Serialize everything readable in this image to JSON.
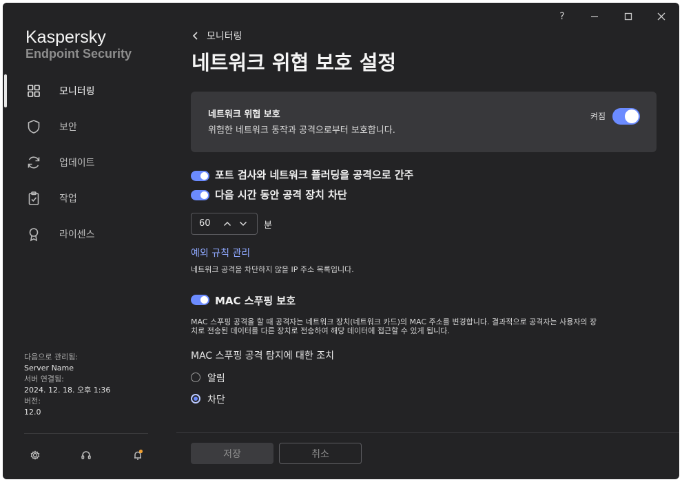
{
  "window": {
    "help_glyph": "?",
    "icons": [
      "help-icon",
      "minimize-icon",
      "maximize-icon",
      "close-icon"
    ]
  },
  "brand": {
    "line1": "Kaspersky",
    "line2": "Endpoint Security"
  },
  "sidebar": {
    "items": [
      {
        "label": "모니터링",
        "icon": "grid-icon",
        "active": true
      },
      {
        "label": "보안",
        "icon": "shield-icon",
        "active": false
      },
      {
        "label": "업데이트",
        "icon": "refresh-icon",
        "active": false
      },
      {
        "label": "작업",
        "icon": "clipboard-check-icon",
        "active": false
      },
      {
        "label": "라이센스",
        "icon": "award-icon",
        "active": false
      }
    ],
    "managed": {
      "managed_by_label": "다음으로 관리됨:",
      "managed_by_value": "Server Name",
      "server_conn_label": "서버 연결됨:",
      "server_conn_value": "2024. 12. 18. 오후 1:36",
      "version_label": "버전:",
      "version_value": "12.0"
    },
    "bottom_icons": [
      "settings-icon",
      "support-headset-icon",
      "notifications-bell-icon"
    ]
  },
  "main": {
    "back_label": "모니터링",
    "title": "네트워크 위협 보호 설정",
    "card": {
      "title": "네트워크 위협 보호",
      "description": "위험한 네트워크 동작과 공격으로부터 보호합니다.",
      "toggle_label": "켜짐"
    },
    "options": {
      "port_scan_label": "포트 검사와 네트워크 플러딩을 공격으로 간주",
      "block_label": "다음 시간 동안 공격 장치 차단",
      "block_value": "60",
      "block_unit": "분",
      "exclusions_link": "예외 규칙 관리",
      "exclusions_desc": "네트워크 공격을 차단하지 않을 IP 주소 목록입니다.",
      "mac_label": "MAC 스푸핑 보호",
      "mac_desc_line1": "MAC 스푸핑 공격을 할 때 공격자는 네트워크 장치(네트워크 카드)의 MAC 주소를 변경합니다. 결과적으로 공격자는 사용자의 장",
      "mac_desc_line2": "치로 전송된 데이터를 다른 장치로 전송하여 해당 데이터에 접근할 수 있게 됩니다.",
      "mac_action_heading": "MAC 스푸핑 공격 탐지에 대한 조치",
      "radio_notify": "알림",
      "radio_block": "차단",
      "selected": "차단"
    },
    "footer": {
      "save_label": "저장",
      "cancel_label": "취소"
    }
  },
  "colors": {
    "window_bg": "#232325",
    "card_bg": "#38383b",
    "accent": "#6b8bff",
    "link": "#8fa8ff"
  }
}
